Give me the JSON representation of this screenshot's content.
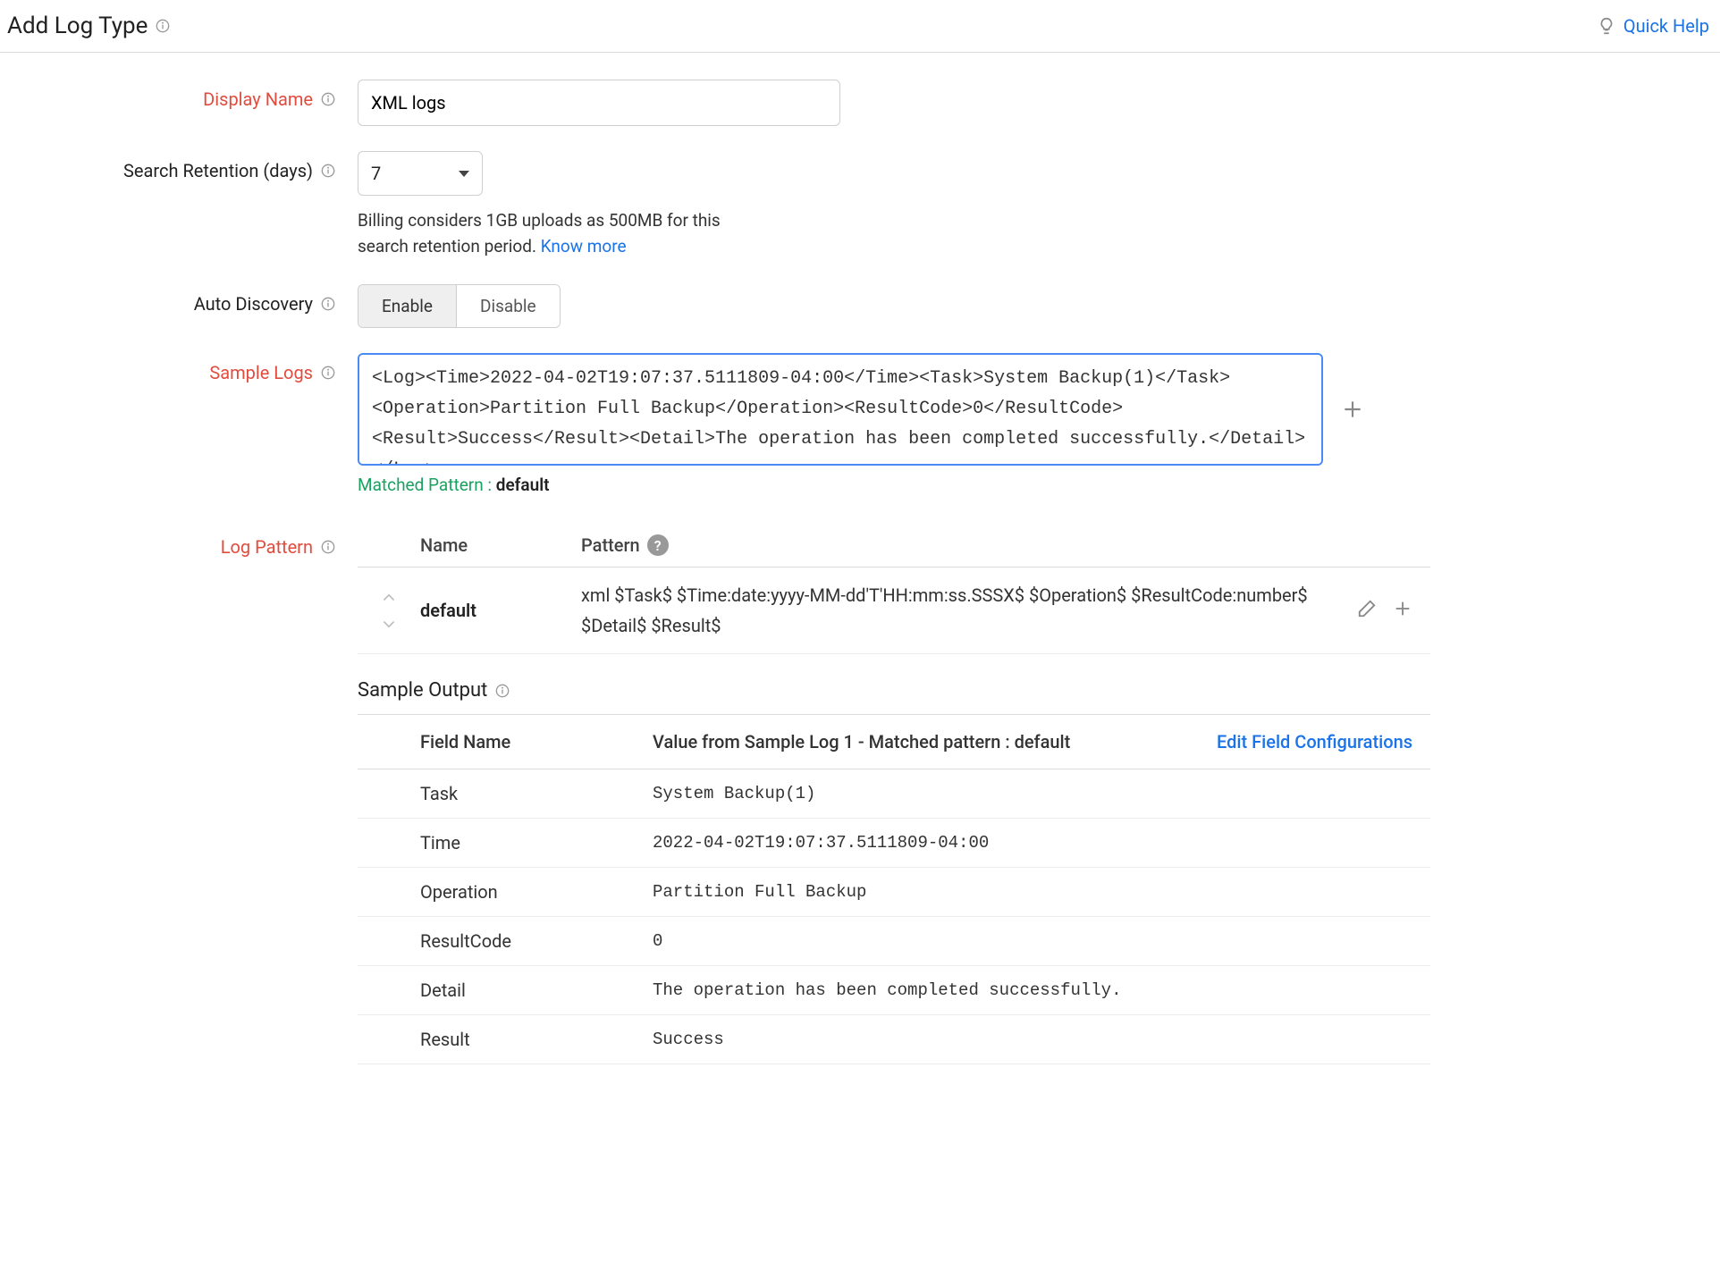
{
  "header": {
    "title": "Add Log Type",
    "quick_help": "Quick Help"
  },
  "form": {
    "display_name": {
      "label": "Display Name",
      "value": "XML logs"
    },
    "retention": {
      "label": "Search Retention (days)",
      "value": "7",
      "hint_prefix": "Billing considers 1GB uploads as 500MB for this search retention period. ",
      "hint_link": "Know more"
    },
    "auto_discovery": {
      "label": "Auto Discovery",
      "enable": "Enable",
      "disable": "Disable"
    },
    "sample_logs": {
      "label": "Sample Logs",
      "value": "<Log><Time>2022-04-02T19:07:37.5111809-04:00</Time><Task>System Backup(1)</Task><Operation>Partition Full Backup</Operation><ResultCode>0</ResultCode><Result>Success</Result><Detail>The operation has been completed successfully.</Detail></Log>"
    },
    "matched": {
      "prefix": "Matched Pattern : ",
      "name": "default"
    },
    "log_pattern": {
      "label": "Log Pattern",
      "col_name": "Name",
      "col_pattern": "Pattern",
      "rows": [
        {
          "name": "default",
          "pattern": "xml $Task$ $Time:date:yyyy-MM-dd'T'HH:mm:ss.SSSX$ $Operation$ $ResultCode:number$ $Detail$ $Result$"
        }
      ]
    },
    "sample_output": {
      "title": "Sample Output",
      "col_field": "Field Name",
      "col_value": "Value from Sample Log 1 - Matched pattern : default",
      "edit_link": "Edit Field Configurations",
      "rows": [
        {
          "name": "Task",
          "value": "System Backup(1)"
        },
        {
          "name": "Time",
          "value": "2022-04-02T19:07:37.5111809-04:00"
        },
        {
          "name": "Operation",
          "value": "Partition Full Backup"
        },
        {
          "name": "ResultCode",
          "value": "0"
        },
        {
          "name": "Detail",
          "value": "The operation has been completed successfully."
        },
        {
          "name": "Result",
          "value": "Success"
        }
      ]
    }
  }
}
